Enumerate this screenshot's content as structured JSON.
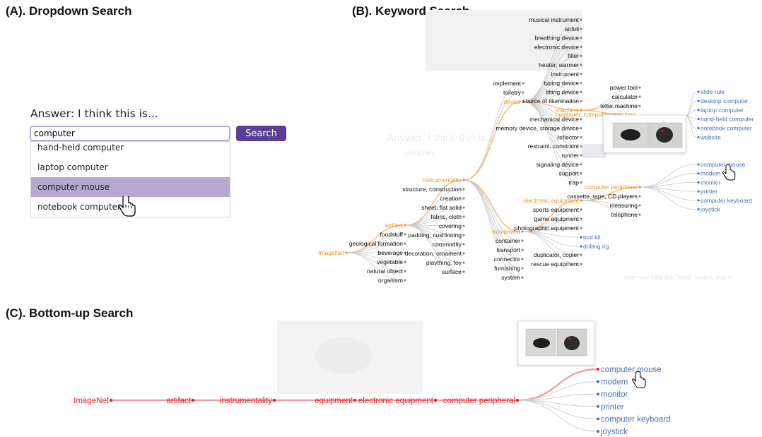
{
  "titles": {
    "a": "(A). Dropdown Search",
    "b": "(B). Keyword Search",
    "c": "(C). Bottom-up Search"
  },
  "dropdown_search": {
    "label": "Answer: I think this is...",
    "input_value": "computer",
    "button_label": "Search",
    "options": [
      "hand-held computer",
      "laptop computer",
      "computer mouse",
      "notebook computer"
    ],
    "selected_option": "computer mouse"
  },
  "keyword_search": {
    "ghost_label": "Answer: I think this is...",
    "ghost_input": "computer",
    "ghost_note": "After you click the \"Next\" button, you w",
    "root": "ImageNet",
    "level1": [
      "artifact",
      "foodstuff",
      "geological formation",
      "beverage",
      "vegetable",
      "natural object",
      "organism"
    ],
    "level2": [
      "instrumentality",
      "structure, construction",
      "creation",
      "sheet, flat solid",
      "fabric, cloth",
      "covering",
      "padding, cushioning",
      "commodity",
      "decoration, ornament",
      "plaything, toy",
      "surface"
    ],
    "instrumentality_children_top": [
      "implement",
      "toiletry",
      "device"
    ],
    "instrumentality_children_bottom": [
      "equipment",
      "container",
      "transport",
      "connector",
      "furnishing",
      "system"
    ],
    "device_children": [
      "musical instrument",
      "airfoil",
      "breathing device",
      "electronic device",
      "filter",
      "heater, warmer",
      "instrument",
      "typing device",
      "lifting device",
      "source of illumination",
      "machine",
      "mechanical device",
      "memory device, storage device",
      "reflector",
      "restraint, constraint",
      "runner",
      "signaling device",
      "support",
      "trap"
    ],
    "machine_children": [
      "power tool",
      "calculator",
      "teller machine",
      "computer, computing machine"
    ],
    "equipment_children": [
      "electronic equipment",
      "sports equipment",
      "game equipment",
      "photographic equipment",
      "tool kit",
      "drilling rig",
      "duplicator, copier",
      "rescue equipment"
    ],
    "electronic_equipment_children": [
      "computer peripheral",
      "cassette, tape, CD players",
      "measuring",
      "telephone"
    ],
    "computer_children": [
      "slide rule",
      "desktop computer",
      "laptop computer",
      "hand-held computer",
      "notebook computer",
      "website"
    ],
    "peripheral_children": [
      "computer mouse",
      "modem",
      "monitor",
      "printer",
      "computer keyboard",
      "joystick"
    ]
  },
  "bottom_up": {
    "path": [
      "ImageNet",
      "artifact",
      "instrumentality",
      "equipment",
      "electronic equipment",
      "computer peripheral"
    ],
    "leaves": [
      "computer mouse",
      "modem",
      "monitor",
      "printer",
      "computer keyboard",
      "joystick"
    ],
    "selected_leaf": "computer mouse"
  },
  "colors": {
    "accent_purple": "#5b3e96",
    "selected_option_bg": "#b6a9d0",
    "highlight_orange": "#e8961e",
    "leaf_blue": "#4a72b0",
    "path_red": "#e0242b"
  },
  "icons": [
    "hand-pointer-icon",
    "mouse-thumbnail-image"
  ]
}
